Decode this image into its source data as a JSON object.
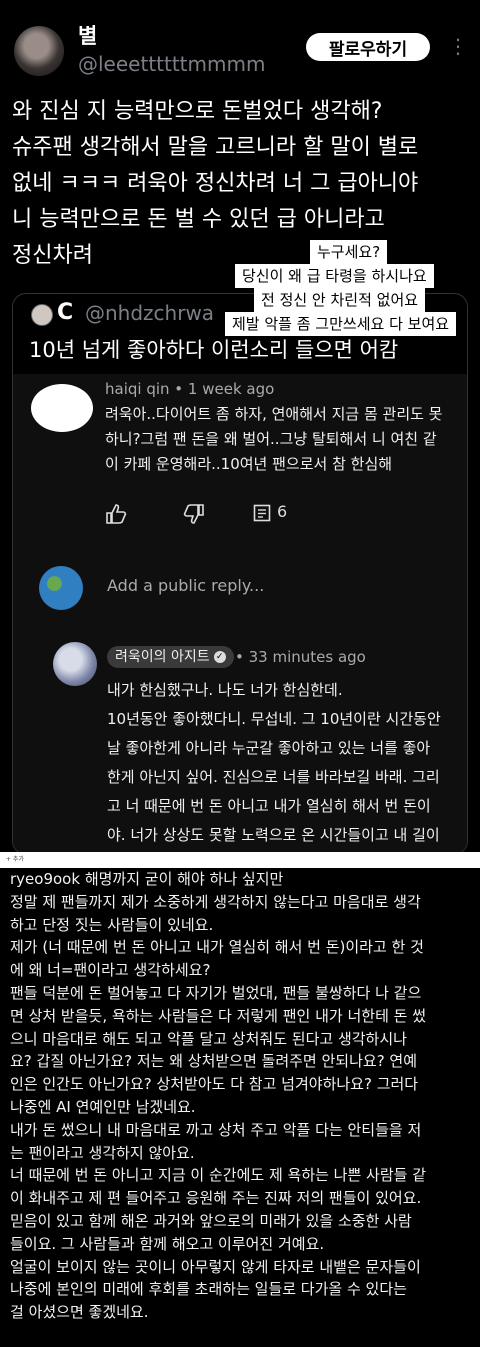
{
  "tweet": {
    "display_name": "별",
    "handle": "@leeettttttmmmm",
    "follow_label": "팔로우하기",
    "more_icon": "⋮",
    "text": "와 진심 지 능력만으로 돈벌었다 생각해?\n슈주팬 생각해서 말을 고르니라 할 말이 별로\n없네 ㅋㅋㅋ 려욱아 정신차려 너 그 급아니야\n니 능력만으로 돈 벌 수 있던 급 아니라고\n정신차려"
  },
  "stickers": [
    "누구세요?",
    "당신이 왜 급 타령을 하시나요",
    "전 정신 안 차린적 없어요",
    "제발 악플 좀 그만쓰세요 다 보여요"
  ],
  "quote": {
    "initial": "C",
    "handle": "@nhdzchrwa",
    "text": "10년 넘게 좋아하다 이런소리 들으면 어캄"
  },
  "youtube": {
    "comment": {
      "author": "haiqi qin",
      "time": "1 week ago",
      "text": "려욱아..다이어트 좀 하자, 연애해서 지금 몸 관리도 못\n하니?그럼 팬 돈을 왜 벌어..그냥 탈퇴해서 니 여친 같\n이 카페 운영해라..10여년 팬으로서 참 한심해",
      "reply_count": "6"
    },
    "reply_placeholder": "Add a public reply...",
    "reply": {
      "author": "려욱이의 아지트",
      "time": "33 minutes ago",
      "text": "내가 한심했구나. 나도 너가 한심한데.\n10년동안 좋아했다니. 무섭네. 그 10년이란 시간동안\n날 좋아한게 아니라 누군갈 좋아하고 있는 너를 좋아\n한게 아닌지 싶어. 진심으로 너를 바라보길 바래. 그리\n고 너 때문에 번 돈 아니고 내가 열심히 해서 번 돈이\n야. 너가 상상도 못할 노력으로 온 시간들이고 내 길이\n야. 함부로 말하지마. 그리고 누군가에게 상처주면서"
    }
  },
  "divider_text": "+ 추가",
  "instagram": {
    "username": "ryeo9ook",
    "text": " 해명까지 굳이 해야 하나 싶지만\n정말 제 팬들까지 제가 소중하게 생각하지 않는다고 마음대로 생각\n하고 단정 짓는 사람들이 있네요.\n제가 (너 때문에 번 돈 아니고 내가 열심히 해서 번 돈)이라고 한 것\n에 왜 너=팬이라고 생각하세요?\n팬들 덕분에 돈 벌어놓고 다 자기가 벌었대, 팬들 불쌍하다 나 같으\n면 상처 받을듯, 욕하는 사람들은 다 저렇게 팬인 내가 너한테 돈 썼\n으니 마음대로 해도 되고 악플 달고 상처줘도 된다고 생각하시나\n요? 갑질 아닌가요? 저는 왜 상처받으면 돌려주면 안되나요? 연예\n인은 인간도 아닌가요? 상처받아도 다 참고 넘겨야하나요? 그러다\n나중엔 AI 연예인만 남겠네요.\n내가 돈 썼으니 내 마음대로 까고 상처 주고 악플 다는 안티들을 저\n는 팬이라고 생각하지 않아요.\n너 때문에 번 돈 아니고 지금 이 순간에도 제 욕하는 나쁜 사람들 같\n이 화내주고 제 편 들어주고 응원해 주는 진짜 저의 팬들이 있어요.\n믿음이 있고 함께 해온 과거와 앞으로의 미래가 있을 소중한 사람\n들이요. 그 사람들과 함께 해오고 이루어진 거예요.\n얼굴이 보이지 않는 곳이니 아무렇지 않게 타자로 내뱉은 문자들이\n나중에 본인의 미래에 후회를 초래하는 일들로 다가올 수 있다는\n걸 아셨으면 좋겠네요."
  }
}
